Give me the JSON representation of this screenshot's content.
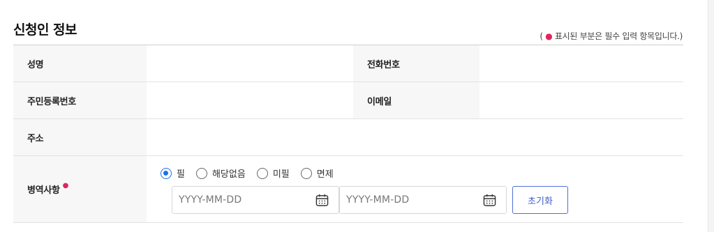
{
  "section": {
    "title": "신청인 정보",
    "required_note_prefix": "( ",
    "required_note_dot": "●",
    "required_note_text": " 표시된 부분은 필수 입력 항목입니다.)"
  },
  "fields": {
    "name_label": "성명",
    "phone_label": "전화번호",
    "rrn_label": "주민등록번호",
    "email_label": "이메일",
    "address_label": "주소",
    "military_label": "병역사항",
    "required_marker": "●"
  },
  "military": {
    "options": [
      {
        "label": "필",
        "checked": true
      },
      {
        "label": "해당없음",
        "checked": false
      },
      {
        "label": "미필",
        "checked": false
      },
      {
        "label": "면제",
        "checked": false
      }
    ],
    "start_date_placeholder": "YYYY-MM-DD",
    "end_date_placeholder": "YYYY-MM-DD",
    "reset_label": "초기화"
  },
  "colors": {
    "accent": "#1a73e8",
    "required": "#e0245e",
    "button_border": "#4f6fd6",
    "label_bg": "#f7f7f7"
  },
  "icons": [
    "calendar-icon"
  ]
}
